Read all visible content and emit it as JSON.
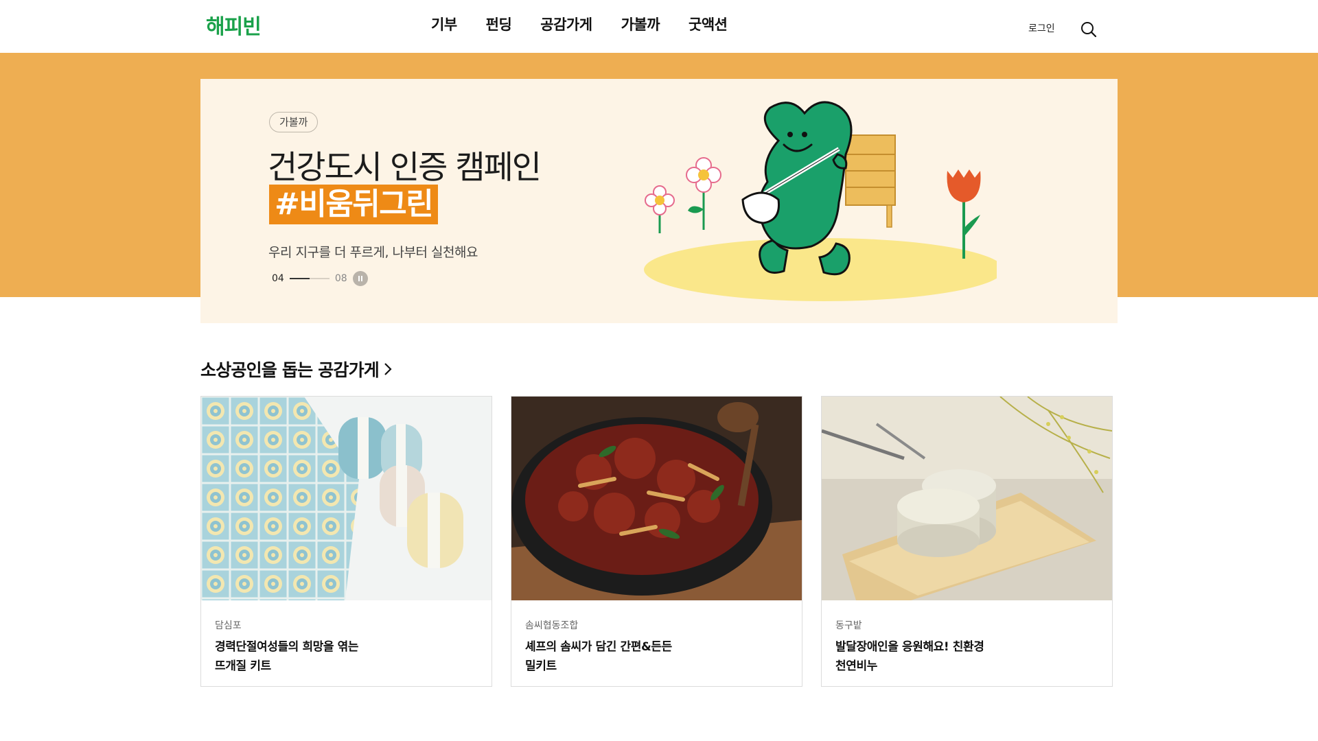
{
  "header": {
    "logo": "해피빈",
    "nav": [
      "기부",
      "펀딩",
      "공감가게",
      "가볼까",
      "굿액션"
    ],
    "login_label": "로그인"
  },
  "hero": {
    "tag": "가볼까",
    "title": "건강도시 인증 캠페인",
    "highlight": "#비움뒤그린",
    "subtitle": "우리 지구를 더 푸르게, 나부터 실천해요",
    "pager_current": "04",
    "pager_total": "08",
    "progress": 0.5,
    "band_color": "#eeae52",
    "card_color": "#fdf4e6",
    "highlight_color": "#ee8a16"
  },
  "section": {
    "title": "소상공인을 돕는 공감가게",
    "cards": [
      {
        "store": "담심포",
        "title_line1": "경력단절여성들의 희망을 엮는",
        "title_line2": "뜨개질 키트",
        "image": "crochet-kit"
      },
      {
        "store": "솜씨협동조합",
        "title_line1": "셰프의 솜씨가 담긴 간편&든든",
        "title_line2": "밀키트",
        "image": "bulgogi-dish"
      },
      {
        "store": "동구밭",
        "title_line1": "발달장애인을 응원해요! 친환경",
        "title_line2": "천연비누",
        "image": "natural-soap"
      }
    ]
  },
  "colors": {
    "brand_green": "#1aa14a"
  }
}
